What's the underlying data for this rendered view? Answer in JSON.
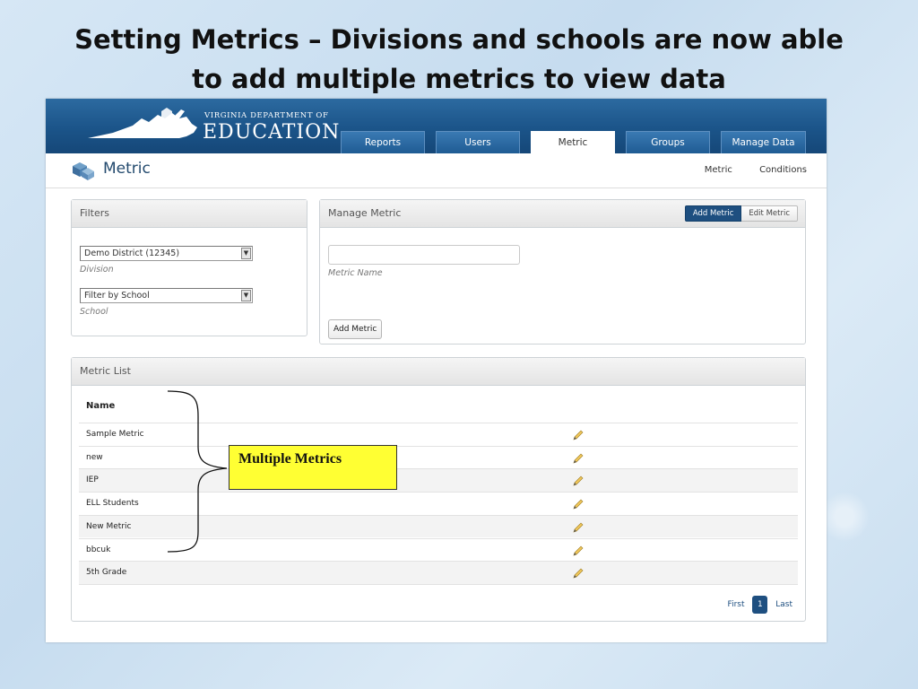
{
  "slide": {
    "title_line1": "Setting Metrics – Divisions and schools are now able",
    "title_line2": "to add multiple metrics to view data"
  },
  "app": {
    "logo_top": "Virginia Department of",
    "logo_main": "EDUCATION",
    "nav_tabs": [
      {
        "label": "Reports"
      },
      {
        "label": "Users"
      },
      {
        "label": "Metric"
      },
      {
        "label": "Groups"
      },
      {
        "label": "Manage Data"
      }
    ],
    "active_tab": "Metric",
    "page_title": "Metric",
    "sub_nav": [
      {
        "label": "Metric"
      },
      {
        "label": "Conditions"
      }
    ]
  },
  "filters": {
    "header": "Filters",
    "division_value": "Demo District (12345)",
    "division_label": "Division",
    "school_value": "Filter by School",
    "school_label": "School"
  },
  "manage_metric": {
    "header": "Manage Metric",
    "add_tab": "Add Metric",
    "edit_tab": "Edit Metric",
    "name_value": "",
    "name_label": "Metric Name",
    "add_button": "Add Metric"
  },
  "metric_list": {
    "header": "Metric List",
    "column_name": "Name",
    "rows": [
      {
        "name": "Sample Metric"
      },
      {
        "name": "new"
      },
      {
        "name": "IEP"
      },
      {
        "name": "ELL Students"
      },
      {
        "name": "New Metric"
      },
      {
        "name": "bbcuk"
      },
      {
        "name": "5th Grade"
      }
    ],
    "pager": {
      "first": "First",
      "page": "1",
      "last": "Last"
    }
  },
  "annotation": {
    "callout_text": "Multiple Metrics"
  },
  "colors": {
    "header_blue": "#1b5489",
    "accent_dark_blue": "#1e4f80",
    "callout_yellow": "#ffff33"
  }
}
